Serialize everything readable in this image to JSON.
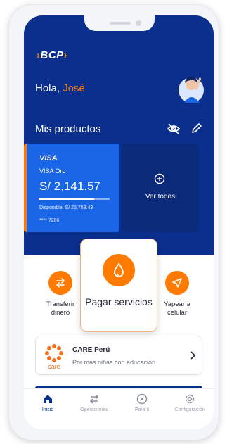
{
  "header": {
    "logo": "BCP",
    "greeting": "Hola, ",
    "user_name": "José"
  },
  "products": {
    "title": "Mis productos",
    "visa_card": {
      "brand": "VISA",
      "type": "VISA Oro",
      "balance": "S/ 2,141.57",
      "available": "Disponible: S/ 25,758.43",
      "number": "**** 7286",
      "progress": 0.78
    },
    "see_all_label": "Ver todos"
  },
  "actions": {
    "transfer": "Transferir dinero",
    "pay_services": "Pagar servicios",
    "yape": "Yapear a celular"
  },
  "banner": {
    "title": "CARE Perú",
    "subtitle": "Por más niñas con educación",
    "logo_text": "care"
  },
  "tabbar": {
    "items": [
      {
        "label": "Inicio",
        "icon": "home-icon"
      },
      {
        "label": "Operaciones",
        "icon": "swap-icon"
      },
      {
        "label": "Para ti",
        "icon": "compass-icon"
      },
      {
        "label": "Configuración",
        "icon": "gear-icon"
      }
    ]
  },
  "colors": {
    "brand_blue": "#0a2f8c",
    "accent_orange": "#ff7a00",
    "card_blue": "#1a64e6"
  }
}
